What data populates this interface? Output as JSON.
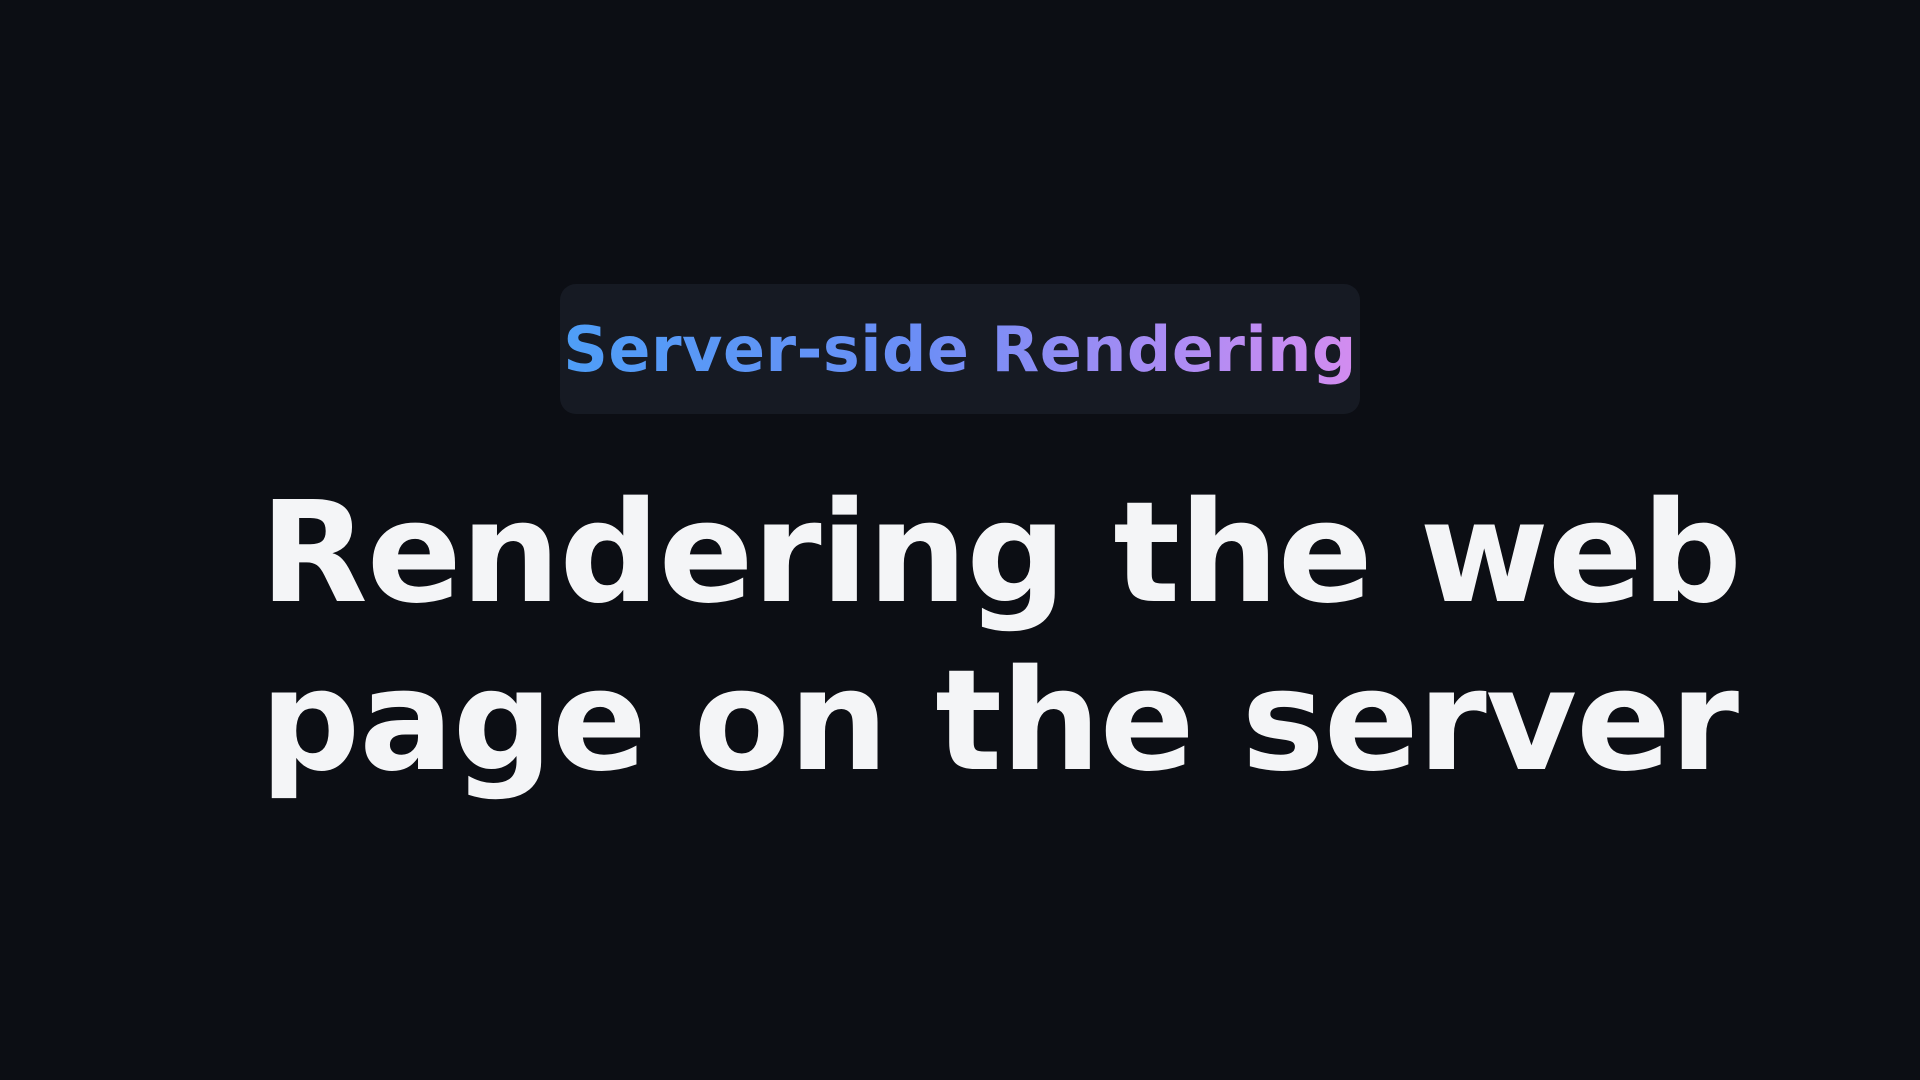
{
  "slide": {
    "tag_label": "Server-side Rendering",
    "headline_lines": [
      "Rendering the web",
      "page on the server"
    ]
  },
  "colors": {
    "background": "#0c0e14",
    "tag_background": "#161a23",
    "tag_gradient_start": "#4e9ef7",
    "tag_gradient_end": "#d38cf0",
    "headline": "#f4f5f7"
  }
}
